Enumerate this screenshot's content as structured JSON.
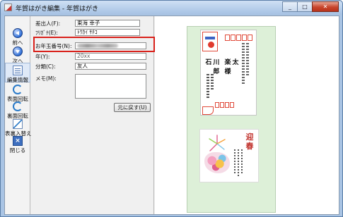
{
  "window": {
    "title": "年賀はがき編集 - 年賀はがき",
    "buttons": {
      "minimize": "_",
      "maximize": "□",
      "close": "✕"
    }
  },
  "toolbar": {
    "items": [
      {
        "label": "前へ",
        "icon": "previous-icon"
      },
      {
        "label": "次へ",
        "icon": "next-icon"
      },
      {
        "label": "編集情報",
        "icon": "edit-info-icon",
        "active": true
      },
      {
        "label": "表面回転",
        "icon": "rotate-front-icon"
      },
      {
        "label": "裏面回転",
        "icon": "rotate-back-icon"
      },
      {
        "label": "表裏入替え",
        "icon": "swap-sides-icon"
      },
      {
        "label": "閉じる",
        "icon": "close-icon"
      }
    ]
  },
  "form": {
    "fields": [
      {
        "label": "差出人(F):",
        "value": "東海 幸子"
      },
      {
        "label": "ﾌﾘｶﾞﾅ(E):",
        "value": "ﾄｳｶｲ ｻﾁｺ"
      },
      {
        "label": "お年玉番号(N):",
        "value": ""
      },
      {
        "label": "年(Y):",
        "value": "20xx"
      },
      {
        "label": "分類(C):",
        "value": "友人"
      },
      {
        "label": "メモ(M):",
        "value": ""
      }
    ],
    "restore_button": "元に戻す(U)"
  },
  "preview": {
    "recipient": "石川 楽太郎 様",
    "greeting_title": "迎春",
    "colors": {
      "background": "#ddf0d8",
      "accent": "#d9201a"
    }
  }
}
